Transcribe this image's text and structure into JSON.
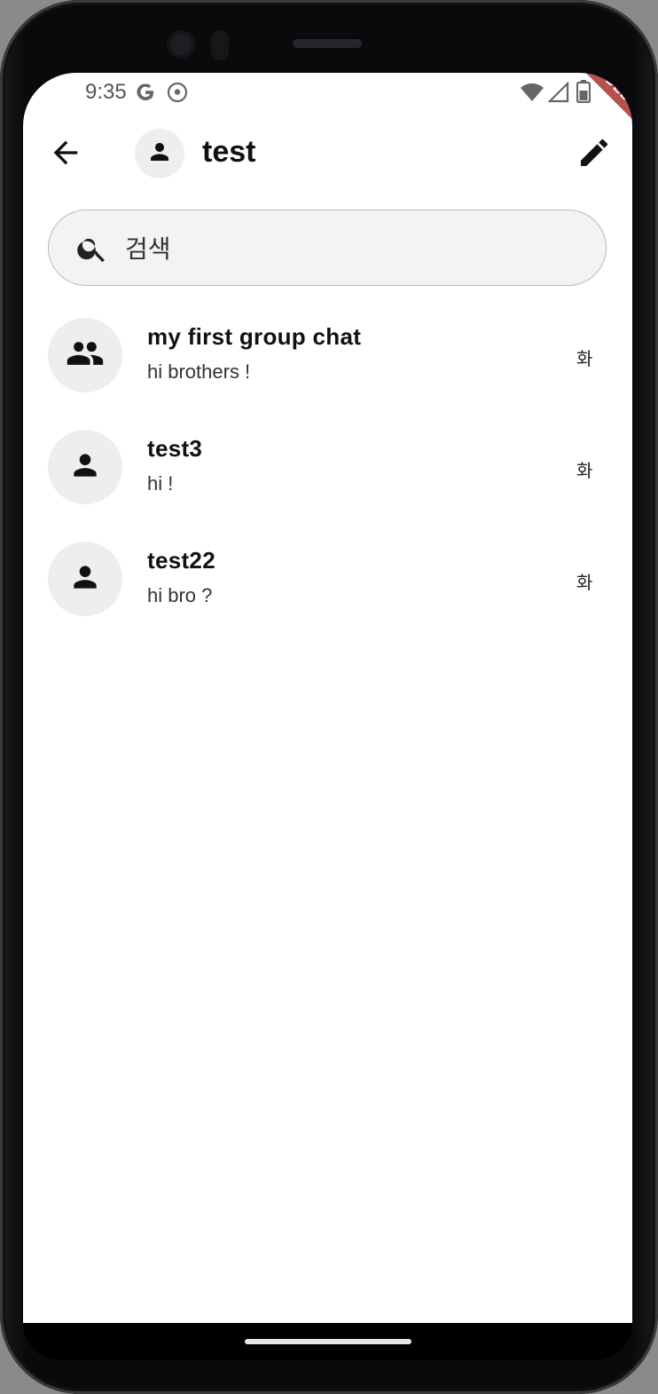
{
  "status_bar": {
    "time": "9:35",
    "icons": [
      "google-icon",
      "soccer-ball-icon",
      "wifi-icon",
      "cell-signal-icon",
      "battery-icon"
    ]
  },
  "debug_banner": "DEBUG",
  "app_bar": {
    "title": "test",
    "back_icon": "arrow-back-icon",
    "edit_icon": "pencil-icon"
  },
  "search": {
    "placeholder": "검색",
    "value": ""
  },
  "chats": [
    {
      "name": "my first group chat",
      "last_message": "hi brothers !",
      "day": "화",
      "avatar": "group-icon"
    },
    {
      "name": "test3",
      "last_message": "hi !",
      "day": "화",
      "avatar": "person-icon"
    },
    {
      "name": "test22",
      "last_message": "hi bro ?",
      "day": "화",
      "avatar": "person-icon"
    }
  ],
  "colors": {
    "avatar_bg": "#eeeeee",
    "search_bg": "#f3f3f3",
    "debug_banner": "#a33333"
  }
}
